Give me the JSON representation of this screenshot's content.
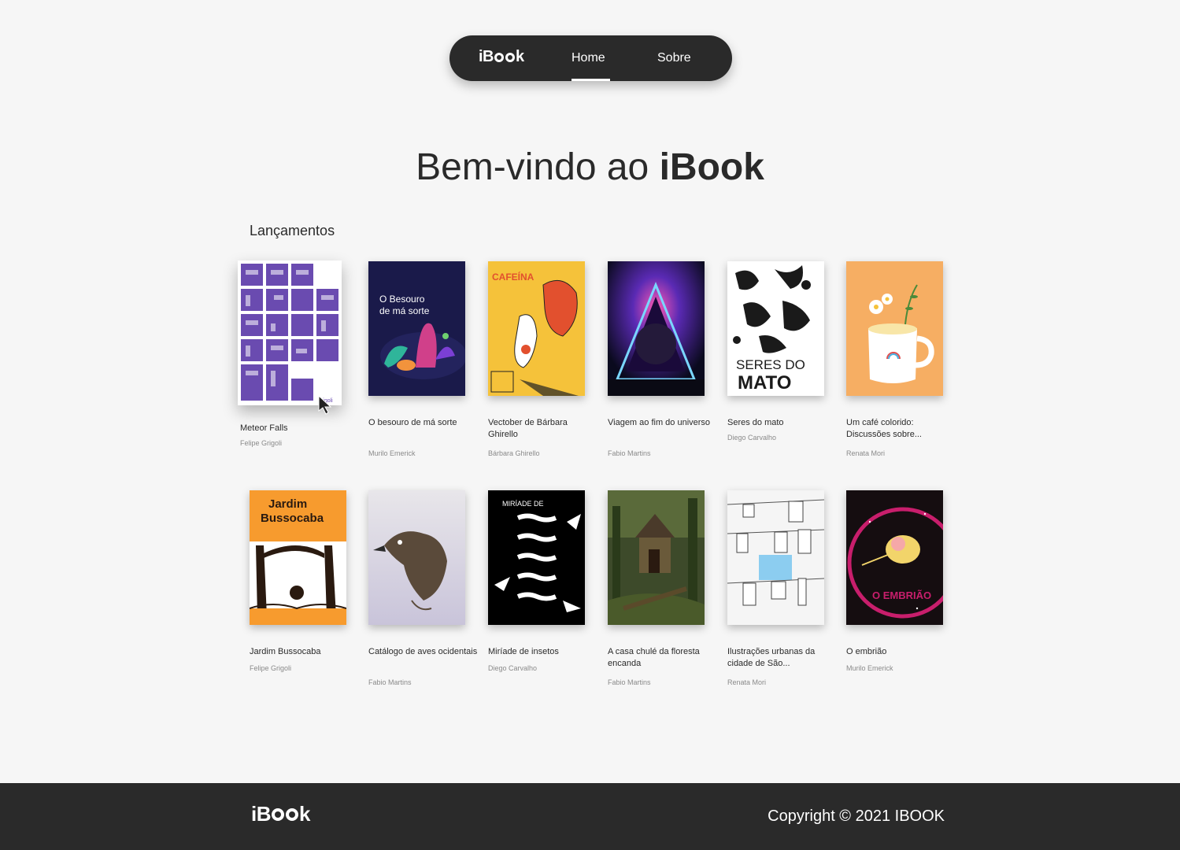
{
  "nav": {
    "logo_prefix": "iB",
    "logo_suffix": "k",
    "links": [
      {
        "label": "Home",
        "active": true
      },
      {
        "label": "Sobre",
        "active": false
      }
    ]
  },
  "hero": {
    "text_regular": "Bem-vindo ao ",
    "text_bold": "iBook"
  },
  "section": {
    "title": "Lançamentos"
  },
  "books": [
    {
      "title": "Meteor Falls",
      "author": "Felipe Grigoli",
      "cover_text": "frigoli",
      "cover_color": "#6a4bb0"
    },
    {
      "title": "O besouro de má sorte",
      "author": "Murilo Emerick",
      "cover_text": "O Besouro de má sorte",
      "cover_color": "#1a1a4a"
    },
    {
      "title": "Vectober de Bárbara Ghirello",
      "author": "Bárbara Ghirello",
      "cover_text": "CAFEÍNA",
      "cover_color": "#f5c23a"
    },
    {
      "title": "Viagem ao fim do universo",
      "author": "Fabio Martins",
      "cover_text": "",
      "cover_color": "#120a2a"
    },
    {
      "title": "Seres do mato",
      "author": "Diego Carvalho",
      "cover_text": "SERES DO MATO",
      "cover_color": "#ffffff"
    },
    {
      "title": "Um café colorido: Discussões sobre...",
      "author": "Renata Mori",
      "cover_text": "",
      "cover_color": "#f6ae63"
    },
    {
      "title": "Jardim Bussocaba",
      "author": "Felipe Grigoli",
      "cover_text": "Jardim Bussocaba",
      "cover_color": "#f79b2e"
    },
    {
      "title": "Catálogo de aves ocidentais",
      "author": "Fabio Martins",
      "cover_text": "",
      "cover_color": "#d8d4d8"
    },
    {
      "title": "Miríade de insetos",
      "author": "Diego Carvalho",
      "cover_text": "MIRÍADE DE INSETOS",
      "cover_color": "#000000"
    },
    {
      "title": "A casa chulé da floresta encanda",
      "author": "Fabio Martins",
      "cover_text": "",
      "cover_color": "#3d4a2a"
    },
    {
      "title": "Ilustrações urbanas da cidade de São...",
      "author": "Renata Mori",
      "cover_text": "",
      "cover_color": "#ededed"
    },
    {
      "title": "O embrião",
      "author": "Murilo Emerick",
      "cover_text": "O EMBRIÃO",
      "cover_color": "#150d10"
    }
  ],
  "footer": {
    "logo_prefix": "iB",
    "logo_suffix": "k",
    "copyright": "Copyright © 2021 IBOOK"
  }
}
